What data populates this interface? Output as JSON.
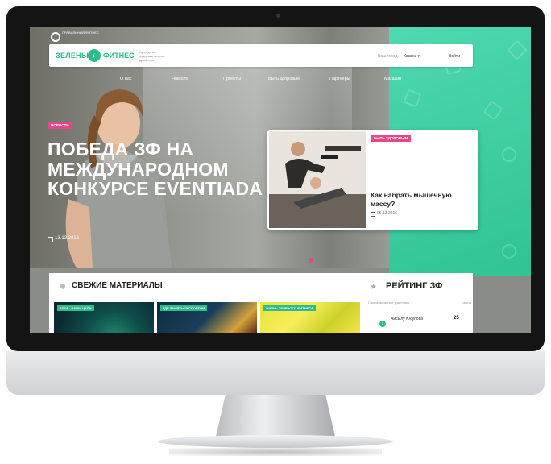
{
  "prog_logo": {
    "text": "Правильный фитнес"
  },
  "header": {
    "logo_left": "ЗЕЛЁНЫЙ",
    "logo_right": "ФИТНЕС",
    "logo_sub": "Культурно-оздоровительное движение",
    "city_label": "Ваш город:",
    "city_value": "Казань ▾",
    "login": "Войти"
  },
  "nav": {
    "items": [
      "О нас",
      "Новости",
      "Проекты",
      "Быть здоровым",
      "Партнеры",
      "Магазин"
    ]
  },
  "hero": {
    "tag": "Новости",
    "headline": "ПОБЕДА ЗФ НА МЕЖДУНАРОДНОМ КОНКУРСЕ EVENTIADA",
    "date": "13.12.2016"
  },
  "card": {
    "tag": "Быть здоровым",
    "title": "Как набрать мышечную массу?",
    "date": "06.12.2016"
  },
  "fresh": {
    "title": "СВЕЖИЕ МАТЕРИАЛЫ",
    "thumbs": [
      {
        "tag": "Блог - наши цели"
      },
      {
        "tag": "Где заняться спортом"
      },
      {
        "tag": "Жизнь зеленого фитнеса"
      }
    ]
  },
  "rating": {
    "title": "РЕЙТИНГ ЗФ",
    "col1": "Самые активные участники",
    "col2": "Баллы",
    "entries": [
      {
        "rank": "1",
        "name": "Айсылу Юсупова",
        "score": "25"
      }
    ]
  },
  "colors": {
    "accent_green": "#2dbd8c",
    "accent_pink": "#e8458b",
    "panel_green": "#4fd8b1"
  }
}
